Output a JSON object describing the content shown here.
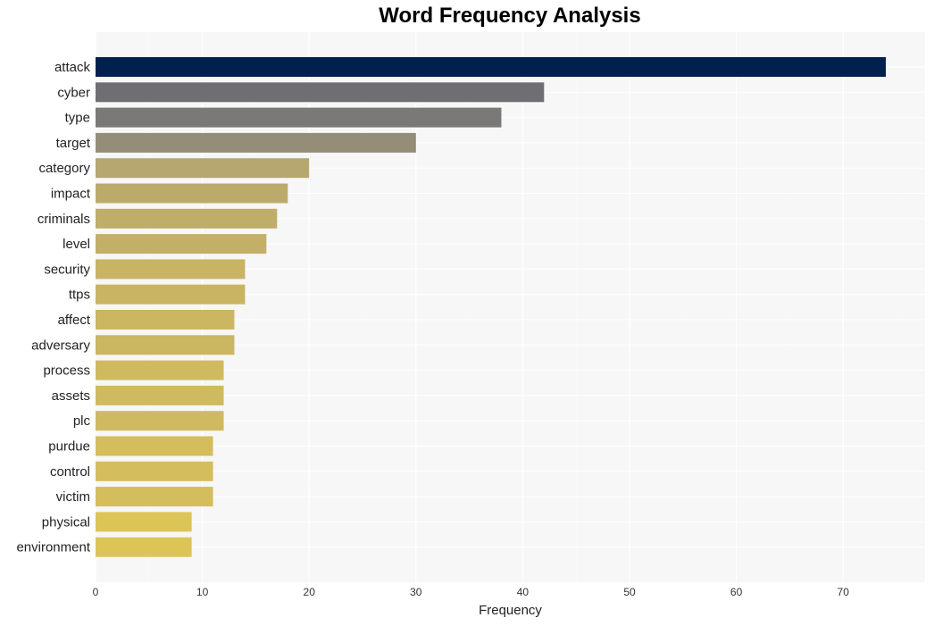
{
  "chart_data": {
    "type": "bar",
    "orientation": "horizontal",
    "title": "Word Frequency Analysis",
    "xlabel": "Frequency",
    "ylabel": "",
    "xlim": [
      0,
      77.6
    ],
    "xticks": [
      0,
      10,
      20,
      30,
      40,
      50,
      60,
      70
    ],
    "grid": true,
    "categories": [
      "attack",
      "cyber",
      "type",
      "target",
      "category",
      "impact",
      "criminals",
      "level",
      "security",
      "ttps",
      "affect",
      "adversary",
      "process",
      "assets",
      "plc",
      "purdue",
      "control",
      "victim",
      "physical",
      "environment"
    ],
    "values": [
      74,
      42,
      38,
      30,
      20,
      18,
      17,
      16,
      14,
      14,
      13,
      13,
      12,
      12,
      12,
      11,
      11,
      11,
      9,
      9
    ],
    "colors": [
      "#00204e",
      "#6f6f73",
      "#7a7977",
      "#948e78",
      "#b5a76f",
      "#bcaa6b",
      "#bfad69",
      "#c3b066",
      "#c8b463",
      "#c8b463",
      "#cbb661",
      "#cbb661",
      "#cfba5f",
      "#cfba5f",
      "#cfba5f",
      "#d4bd5d",
      "#d4bd5d",
      "#d4bd5d",
      "#ddc457",
      "#ddc457"
    ]
  }
}
